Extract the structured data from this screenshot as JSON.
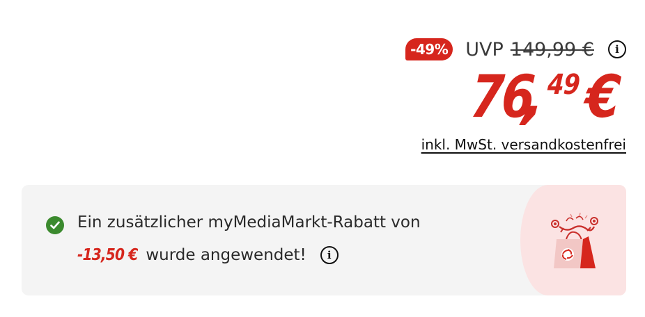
{
  "price": {
    "discount_badge": "-49%",
    "uvp_label": "UVP",
    "uvp_price": "149,99 €",
    "current_euros": "76",
    "current_comma": ",",
    "current_cents": "49",
    "currency": "€",
    "shipping_text": "inkl. MwSt. versandkostenfrei"
  },
  "notice": {
    "line1": "Ein zusätzlicher myMediaMarkt-Rabatt von",
    "amount": "-13,50 €",
    "line2_suffix": "wurde angewendet!"
  },
  "icons": {
    "info": "info-icon",
    "check": "check-circle-icon",
    "gift": "shopping-bag-gift-icon"
  },
  "colors": {
    "brand_red": "#d6261d",
    "success_green": "#3b8a2e",
    "card_background": "#f4f4f4",
    "art_background": "#fbe3e3"
  }
}
